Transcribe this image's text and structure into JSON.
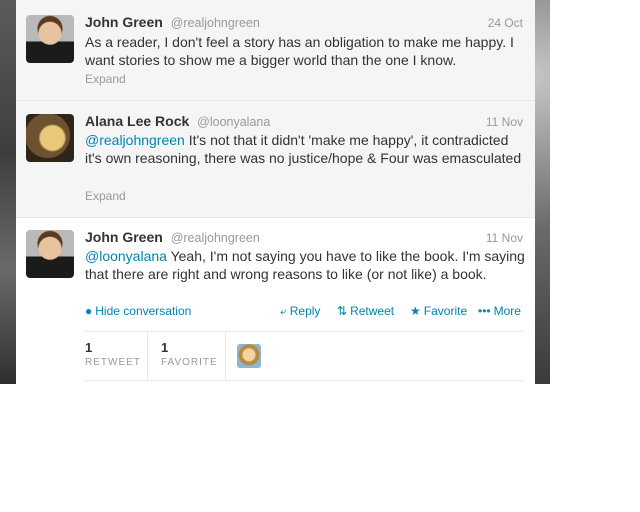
{
  "tweets": [
    {
      "name": "John Green",
      "handle": "@realjohngreen",
      "time": "24 Oct",
      "text": "As a reader, I don't feel a story has an obligation to make me happy. I want stories to show me a bigger world than the one I know.",
      "expand": "Expand"
    },
    {
      "name": "Alana Lee Rock",
      "handle": "@loonyalana",
      "time": "11 Nov",
      "mention": "@realjohngreen",
      "text": " It's not that it didn't 'make me happy', it contradicted it's own reasoning, there was no justice/hope & Four was emasculated",
      "expand": "Expand"
    },
    {
      "name": "John Green",
      "handle": "@realjohngreen",
      "time": "11 Nov",
      "mention": "@loonyalana",
      "text": " Yeah, I'm not saying you have to like the book. I'm saying that there are right and wrong reasons to like (or not like) a book."
    }
  ],
  "actions": {
    "hide_conversation": "Hide conversation",
    "reply": "Reply",
    "retweet": "Retweet",
    "favorite": "Favorite",
    "more": "More"
  },
  "stats": {
    "retweet_count": "1",
    "retweet_label": "RETWEET",
    "favorite_count": "1",
    "favorite_label": "FAVORITE"
  },
  "colors": {
    "link": "#0084b4",
    "muted": "#999999",
    "text": "#333333"
  }
}
